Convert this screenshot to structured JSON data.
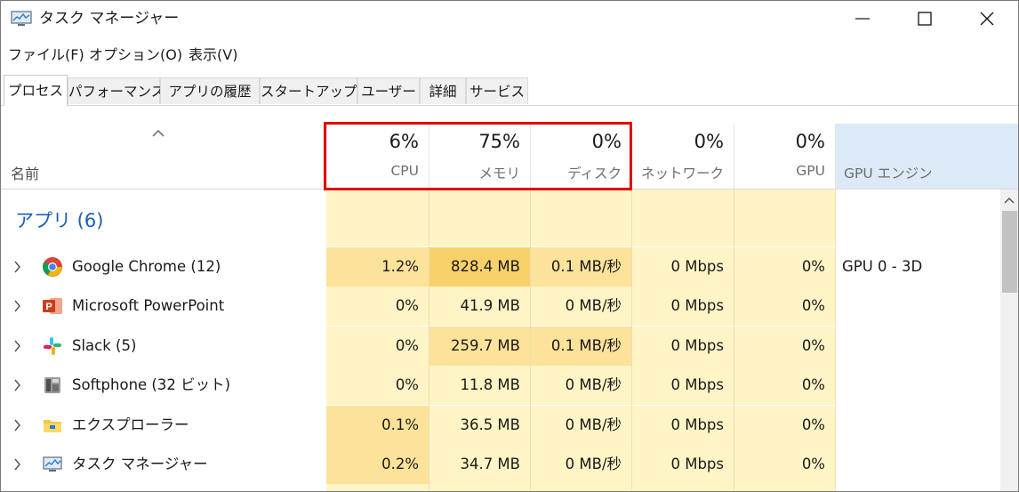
{
  "window": {
    "title": "タスク マネージャー",
    "icon": "task-manager-icon"
  },
  "menu": [
    {
      "label": "ファイル(F)"
    },
    {
      "label": "オプション(O)"
    },
    {
      "label": "表示(V)"
    }
  ],
  "tabs": [
    {
      "label": "プロセス",
      "active": true
    },
    {
      "label": "パフォーマンス"
    },
    {
      "label": "アプリの履歴"
    },
    {
      "label": "スタートアップ"
    },
    {
      "label": "ユーザー"
    },
    {
      "label": "詳細"
    },
    {
      "label": "サービス"
    }
  ],
  "columns": {
    "name": "名前",
    "cpu": {
      "total": "6%",
      "label": "CPU"
    },
    "memory": {
      "total": "75%",
      "label": "メモリ"
    },
    "disk": {
      "total": "0%",
      "label": "ディスク"
    },
    "network": {
      "total": "0%",
      "label": "ネットワーク"
    },
    "gpu": {
      "total": "0%",
      "label": "GPU"
    },
    "gpu_engine": {
      "label": "GPU エンジン"
    }
  },
  "group": {
    "label": "アプリ (6)"
  },
  "rows": [
    {
      "name": "Google Chrome (12)",
      "icon": "chrome-icon",
      "cpu": "1.2%",
      "memory": "828.4 MB",
      "disk": "0.1 MB/秒",
      "network": "0 Mbps",
      "gpu": "0%",
      "gpu_engine": "GPU 0 - 3D"
    },
    {
      "name": "Microsoft PowerPoint",
      "icon": "powerpoint-icon",
      "cpu": "0%",
      "memory": "41.9 MB",
      "disk": "0 MB/秒",
      "network": "0 Mbps",
      "gpu": "0%",
      "gpu_engine": ""
    },
    {
      "name": "Slack (5)",
      "icon": "slack-icon",
      "cpu": "0%",
      "memory": "259.7 MB",
      "disk": "0.1 MB/秒",
      "network": "0 Mbps",
      "gpu": "0%",
      "gpu_engine": ""
    },
    {
      "name": "Softphone (32 ビット)",
      "icon": "softphone-icon",
      "cpu": "0%",
      "memory": "11.8 MB",
      "disk": "0 MB/秒",
      "network": "0 Mbps",
      "gpu": "0%",
      "gpu_engine": ""
    },
    {
      "name": "エクスプローラー",
      "icon": "folder-icon",
      "cpu": "0.1%",
      "memory": "36.5 MB",
      "disk": "0 MB/秒",
      "network": "0 Mbps",
      "gpu": "0%",
      "gpu_engine": ""
    },
    {
      "name": "タスク マネージャー",
      "icon": "task-manager-icon",
      "cpu": "0.2%",
      "memory": "34.7 MB",
      "disk": "0 MB/秒",
      "network": "0 Mbps",
      "gpu": "0%",
      "gpu_engine": ""
    }
  ],
  "colors": {
    "accent_group": "#1b5fb4",
    "highlight_border": "#e30000",
    "gpu_engine_header": "#dceaf7"
  }
}
